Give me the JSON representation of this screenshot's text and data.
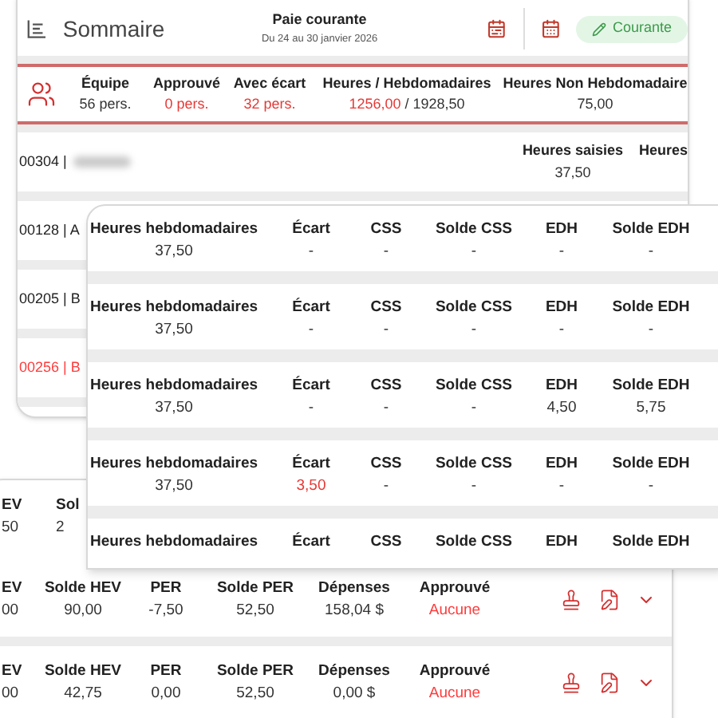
{
  "summary_window": {
    "header": {
      "title": "Sommaire",
      "period_title": "Paie courante",
      "period_dates": "Du 24 au 30 janvier 2026",
      "status_label": "Courante"
    },
    "stats": [
      {
        "label": "Équipe",
        "parts": [
          {
            "text": "56 pers.",
            "alert": false
          }
        ]
      },
      {
        "label": "Approuvé",
        "parts": [
          {
            "text": "0 pers.",
            "alert": true
          }
        ]
      },
      {
        "label": "Avec écart",
        "parts": [
          {
            "text": "32 pers.",
            "alert": true
          }
        ]
      },
      {
        "label": "Heures / Hebdomadaires",
        "parts": [
          {
            "text": "1256,00",
            "alert": true
          },
          {
            "text": " / 1928,50",
            "alert": false
          }
        ]
      },
      {
        "label": "Heures Non Hebdomadaire",
        "parts": [
          {
            "text": "75,00",
            "alert": false
          }
        ]
      }
    ],
    "employees": [
      {
        "name": "00304 |",
        "alert": false,
        "fields": [
          {
            "label": "Heures saisies",
            "value": "37,50"
          },
          {
            "label": "Heures"
          }
        ]
      },
      {
        "name": "00128 | A",
        "alert": false
      },
      {
        "name": "00205 | B",
        "alert": false
      },
      {
        "name": "00256 | B",
        "alert": true
      }
    ]
  },
  "hours_window": {
    "rows": [
      {
        "cells": [
          {
            "label": "Heures hebdomadaires",
            "value": "37,50",
            "alert": false
          },
          {
            "label": "Écart",
            "value": "-",
            "alert": false
          },
          {
            "label": "CSS",
            "value": "-",
            "alert": false
          },
          {
            "label": "Solde CSS",
            "value": "-",
            "alert": false
          },
          {
            "label": "EDH",
            "value": "-",
            "alert": false
          },
          {
            "label": "Solde EDH",
            "value": "-",
            "alert": false
          }
        ]
      },
      {
        "cells": [
          {
            "label": "Heures hebdomadaires",
            "value": "37,50",
            "alert": false
          },
          {
            "label": "Écart",
            "value": "-",
            "alert": false
          },
          {
            "label": "CSS",
            "value": "-",
            "alert": false
          },
          {
            "label": "Solde CSS",
            "value": "-",
            "alert": false
          },
          {
            "label": "EDH",
            "value": "-",
            "alert": false
          },
          {
            "label": "Solde EDH",
            "value": "-",
            "alert": false
          }
        ]
      },
      {
        "cells": [
          {
            "label": "Heures hebdomadaires",
            "value": "37,50",
            "alert": false
          },
          {
            "label": "Écart",
            "value": "-",
            "alert": false
          },
          {
            "label": "CSS",
            "value": "-",
            "alert": false
          },
          {
            "label": "Solde CSS",
            "value": "-",
            "alert": false
          },
          {
            "label": "EDH",
            "value": "4,50",
            "alert": false
          },
          {
            "label": "Solde EDH",
            "value": "5,75",
            "alert": false
          }
        ]
      },
      {
        "cells": [
          {
            "label": "Heures hebdomadaires",
            "value": "37,50",
            "alert": false
          },
          {
            "label": "Écart",
            "value": "3,50",
            "alert": true
          },
          {
            "label": "CSS",
            "value": "-",
            "alert": false
          },
          {
            "label": "Solde CSS",
            "value": "-",
            "alert": false
          },
          {
            "label": "EDH",
            "value": "-",
            "alert": false
          },
          {
            "label": "Solde EDH",
            "value": "-",
            "alert": false
          }
        ]
      },
      {
        "cells": [
          {
            "label": "Heures hebdomadaires"
          },
          {
            "label": "Écart"
          },
          {
            "label": "CSS"
          },
          {
            "label": "Solde CSS"
          },
          {
            "label": "EDH"
          },
          {
            "label": "Solde EDH"
          }
        ]
      }
    ]
  },
  "expenses_window": {
    "rows": [
      {
        "kind": "partial",
        "cells": [
          {
            "label": "EV",
            "value": "50",
            "alert": false
          },
          {
            "label": "Sol",
            "value": "2",
            "alert": false
          }
        ]
      },
      {
        "kind": "full",
        "cells": [
          {
            "label": "EV",
            "value": "00",
            "alert": false
          },
          {
            "label": "Solde HEV",
            "value": "90,00",
            "alert": false
          },
          {
            "label": "PER",
            "value": "-7,50",
            "alert": false
          },
          {
            "label": "Solde PER",
            "value": "52,50",
            "alert": false
          },
          {
            "label": "Dépenses",
            "value": "158,04 $",
            "alert": false
          },
          {
            "label": "Approuvé",
            "value": "Aucune",
            "alert": true
          }
        ]
      },
      {
        "kind": "full",
        "cells": [
          {
            "label": "EV",
            "value": "00",
            "alert": false
          },
          {
            "label": "Solde HEV",
            "value": "42,75",
            "alert": false
          },
          {
            "label": "PER",
            "value": "0,00",
            "alert": false
          },
          {
            "label": "Solde PER",
            "value": "52,50",
            "alert": false
          },
          {
            "label": "Dépenses",
            "value": "0,00 $",
            "alert": false
          },
          {
            "label": "Approuvé",
            "value": "Aucune",
            "alert": true
          }
        ]
      }
    ]
  }
}
